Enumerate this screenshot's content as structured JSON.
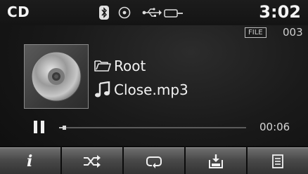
{
  "header": {
    "mode_label": "CD",
    "clock": "3:02",
    "status_icons": [
      "bluetooth-icon",
      "disc-icon",
      "usb-icon",
      "aux-jack-icon"
    ]
  },
  "track": {
    "file_badge": "FILE",
    "track_number": "003",
    "folder_name": "Root",
    "file_name": "Close.mp3",
    "elapsed": "00:06",
    "progress": 0.02,
    "state": "paused"
  },
  "softkeys": [
    {
      "icon": "info-icon",
      "glyph": "i"
    },
    {
      "icon": "shuffle-icon"
    },
    {
      "icon": "repeat-icon"
    },
    {
      "icon": "save-icon"
    },
    {
      "icon": "list-icon"
    }
  ],
  "colors": {
    "background": "#1a1a1a",
    "text": "#f2f2f2",
    "softkey": "#555555"
  }
}
